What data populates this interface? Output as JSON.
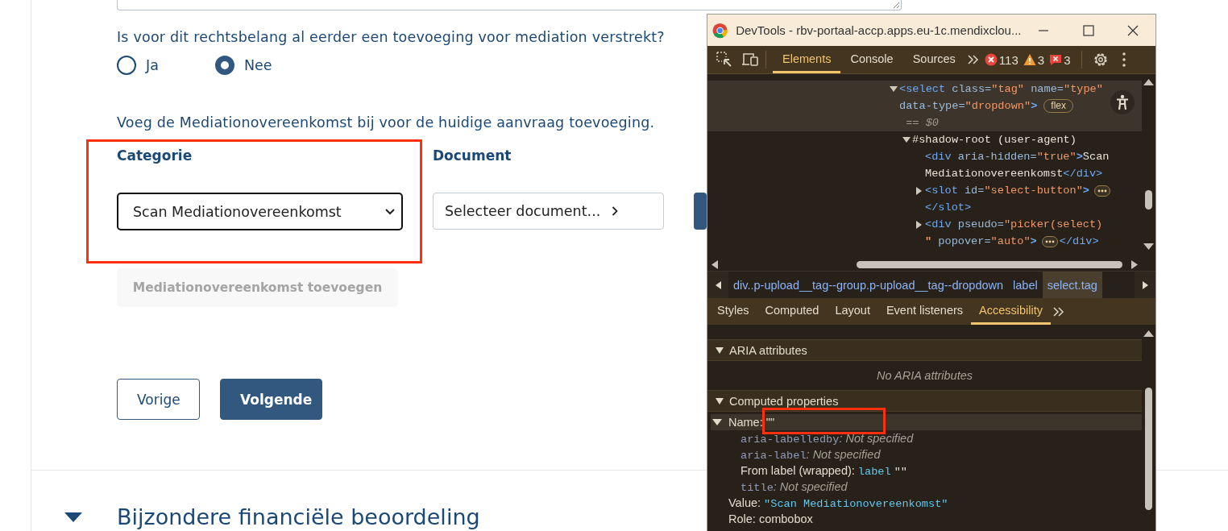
{
  "page": {
    "question": "Is voor dit rechtsbelang al eerder een toevoeging voor mediation verstrekt?",
    "radios": [
      {
        "label": "Ja",
        "selected": false
      },
      {
        "label": "Nee",
        "selected": true
      }
    ],
    "instruction": "Voeg de Mediationovereenkomst bij voor de huidige aanvraag toevoeging.",
    "category": {
      "label": "Categorie",
      "value": "Scan Mediationovereenkomst",
      "highlighted": true
    },
    "document": {
      "label": "Document",
      "button": "Selecteer document..."
    },
    "add_button": {
      "label": "Mediationovereenkomst toevoegen",
      "disabled": true
    },
    "nav_buttons": [
      {
        "label": "Vorige",
        "kind": "secondary"
      },
      {
        "label": "Volgende",
        "kind": "primary"
      }
    ],
    "section": {
      "title": "Bijzondere financiële beoordeling",
      "expanded": true
    }
  },
  "devtools": {
    "title": "DevTools - rbv-portaal-accp.apps.eu-1c.mendixclou...",
    "tabs": [
      {
        "label": "Elements",
        "selected": true
      },
      {
        "label": "Console",
        "selected": false
      },
      {
        "label": "Sources",
        "selected": false
      }
    ],
    "counts": [
      {
        "kind": "error",
        "count": "113"
      },
      {
        "kind": "warning",
        "count": "3"
      },
      {
        "kind": "issue",
        "count": "3"
      }
    ],
    "dom": [
      {
        "kind": "branch",
        "expanded": true,
        "selected": true,
        "lines": [
          [
            {
              "kind": "code",
              "parts": [
                {
                  "color": "#6fa8f0",
                  "s": "<select"
                },
                {
                  "color": "#9bbbdc",
                  "s": " class="
                },
                {
                  "color": "#f29766",
                  "s": "\"tag\""
                },
                {
                  "color": "#9bbbdc",
                  "s": " name="
                },
                {
                  "color": "#f29766",
                  "s": "\"type\""
                }
              ]
            }
          ],
          [
            {
              "kind": "code",
              "parts": [
                {
                  "color": "#9bbbdc",
                  "s": "data-type="
                },
                {
                  "color": "#f29766",
                  "s": "\"dropdown\""
                },
                {
                  "color": "#6fa8f0",
                  "s": ">"
                }
              ]
            },
            {
              "kind": "badge",
              "text": "flex"
            }
          ],
          [
            {
              "kind": "ref",
              "parts": [
                {
                  "color": "#a09a90",
                  "s": " == $0"
                }
              ]
            }
          ]
        ],
        "children": [
          {
            "kind": "branch",
            "expanded": true,
            "selected": false,
            "lines": [
              [
                {
                  "kind": "code",
                  "parts": [
                    {
                      "color": "#e8e2d6",
                      "s": "#shadow-root (user-agent)"
                    }
                  ]
                }
              ]
            ],
            "children": [
              {
                "kind": "leaf",
                "selected": false,
                "lines": [
                  [
                    {
                      "kind": "code",
                      "parts": [
                        {
                          "color": "#6fa8f0",
                          "s": "<div"
                        },
                        {
                          "color": "#9bbbdc",
                          "s": " aria-hidden="
                        },
                        {
                          "color": "#f29766",
                          "s": "\"true\""
                        },
                        {
                          "color": "#6fa8f0",
                          "s": ">"
                        },
                        {
                          "color": "#e8e2d6",
                          "s": "Scan"
                        }
                      ]
                    }
                  ],
                  [
                    {
                      "kind": "code",
                      "parts": [
                        {
                          "color": "#e8e2d6",
                          "s": "Mediationovereenkomst"
                        },
                        {
                          "color": "#6fa8f0",
                          "s": "</div>"
                        }
                      ]
                    }
                  ]
                ]
              },
              {
                "kind": "branch",
                "expanded": false,
                "selected": false,
                "lines": [
                  [
                    {
                      "kind": "code",
                      "parts": [
                        {
                          "color": "#6fa8f0",
                          "s": "<slot"
                        },
                        {
                          "color": "#9bbbdc",
                          "s": " id="
                        },
                        {
                          "color": "#f29766",
                          "s": "\"select-button\""
                        },
                        {
                          "color": "#6fa8f0",
                          "s": ">"
                        }
                      ]
                    },
                    {
                      "kind": "ellipsis"
                    }
                  ],
                  [
                    {
                      "kind": "code",
                      "parts": [
                        {
                          "color": "#6fa8f0",
                          "s": "</slot>"
                        }
                      ]
                    }
                  ]
                ]
              },
              {
                "kind": "branch",
                "expanded": false,
                "selected": false,
                "lines": [
                  [
                    {
                      "kind": "code",
                      "parts": [
                        {
                          "color": "#6fa8f0",
                          "s": "<div"
                        },
                        {
                          "color": "#9bbbdc",
                          "s": " pseudo="
                        },
                        {
                          "color": "#f29766",
                          "s": "\"picker(select)"
                        }
                      ]
                    }
                  ],
                  [
                    {
                      "kind": "code",
                      "parts": [
                        {
                          "color": "#f29766",
                          "s": "\""
                        },
                        {
                          "color": "#9bbbdc",
                          "s": " popover="
                        },
                        {
                          "color": "#f29766",
                          "s": "\"auto\""
                        },
                        {
                          "color": "#6fa8f0",
                          "s": ">"
                        }
                      ]
                    },
                    {
                      "kind": "ellipsis"
                    },
                    {
                      "kind": "code",
                      "parts": [
                        {
                          "color": "#6fa8f0",
                          "s": "</div>"
                        }
                      ]
                    }
                  ]
                ]
              }
            ]
          }
        ]
      }
    ],
    "breadcrumbs": [
      {
        "label": "div..p-upload__tag--group.p-upload__tag--dropdown",
        "selected": false
      },
      {
        "label": "label",
        "selected": false
      },
      {
        "label": "select.tag",
        "selected": true
      }
    ],
    "panel_tabs": [
      {
        "label": "Styles",
        "selected": false
      },
      {
        "label": "Computed",
        "selected": false
      },
      {
        "label": "Layout",
        "selected": false
      },
      {
        "label": "Event listeners",
        "selected": false
      },
      {
        "label": "Accessibility",
        "selected": true
      }
    ],
    "aria_section": {
      "title": "ARIA attributes",
      "expanded": true,
      "empty_text": "No ARIA attributes"
    },
    "computed_section": {
      "title": "Computed properties",
      "expanded": true,
      "properties": [
        {
          "name": "Name:",
          "value": "\"\"",
          "expanded": true,
          "selected": true,
          "highlighted": true,
          "children": [
            {
              "kind": "attribute",
              "name": "aria-labelledby",
              "value": ": Not specified"
            },
            {
              "kind": "attribute",
              "name": "aria-label",
              "value": ": Not specified"
            },
            {
              "kind": "source",
              "name": "From label (wrapped):",
              "value": "label",
              "extra": "\"\""
            },
            {
              "kind": "attribute",
              "name": "title",
              "value": ": Not specified"
            }
          ]
        },
        {
          "name": "Value:",
          "value": "\"Scan Mediationovereenkomst\"",
          "kind": "string",
          "selected": false,
          "highlighted": false
        },
        {
          "name": "Role:",
          "value": "combobox",
          "kind": "plain",
          "selected": false,
          "highlighted": false
        }
      ]
    }
  }
}
